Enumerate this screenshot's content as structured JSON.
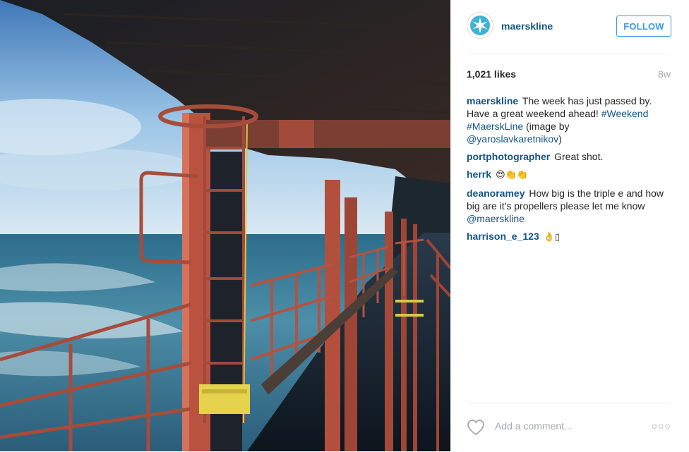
{
  "post": {
    "username": "maerskline",
    "follow_label": "FOLLOW",
    "likes": "1,021 likes",
    "age": "8w"
  },
  "caption": {
    "user": "maerskline",
    "text_part1": " The week has just passed by. Have a great weekend ahead! ",
    "tag1": "#Weekend",
    "tag2": "#MaerskLine",
    "text_part2": " (image by ",
    "mention": "@yaroslavkaretnikov",
    "text_part3": ")"
  },
  "comments": [
    {
      "user": "portphotographer",
      "text": " Great shot."
    },
    {
      "user": "herrk",
      "text": " 😍👏👏"
    },
    {
      "user": "deanoramey",
      "text": " How big is the triple e and how big are it's propellers please let me know ",
      "mention": "@maerskline"
    },
    {
      "user": "harrison_e_123",
      "text": " 👌▯"
    }
  ],
  "footer": {
    "comment_placeholder": "Add a comment...",
    "more_label": "○○○"
  },
  "icons": {
    "logo": "star-logo-icon",
    "like": "heart-icon",
    "more": "more-options-icon"
  },
  "colors": {
    "username": "#125688",
    "follow": "#3897f0",
    "muted": "#a5a7aa",
    "brand": "#42b0d5"
  }
}
